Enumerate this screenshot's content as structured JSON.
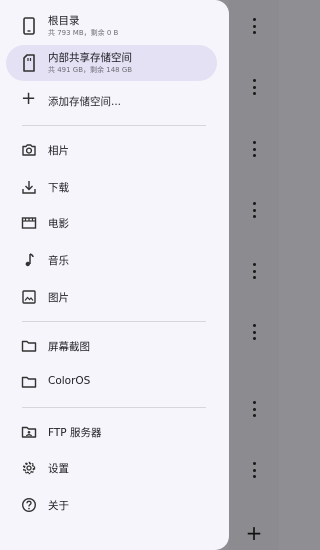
{
  "storage": [
    {
      "title": "根目录",
      "subtitle": "共 793 MB，剩余 0 B",
      "icon": "phone-icon",
      "active": false
    },
    {
      "title": "内部共享存储空间",
      "subtitle": "共 491 GB，剩余 148 GB",
      "icon": "sd-card-icon",
      "active": true
    }
  ],
  "add_storage": {
    "label": "添加存储空间..."
  },
  "library": [
    {
      "label": "相片",
      "icon": "camera-icon"
    },
    {
      "label": "下载",
      "icon": "download-icon"
    },
    {
      "label": "电影",
      "icon": "movie-icon"
    },
    {
      "label": "音乐",
      "icon": "music-note-icon"
    },
    {
      "label": "图片",
      "icon": "image-icon"
    }
  ],
  "bookmarks": [
    {
      "label": "屏幕截图",
      "icon": "folder-icon"
    },
    {
      "label": "ColorOS",
      "icon": "folder-icon"
    }
  ],
  "tools": [
    {
      "label": "FTP 服务器",
      "icon": "ftp-folder-icon"
    },
    {
      "label": "设置",
      "icon": "gear-icon"
    },
    {
      "label": "关于",
      "icon": "help-icon"
    }
  ],
  "colors": {
    "drawer_bg": "#f6f5fb",
    "active_bg": "#e3e1f3",
    "scrim": "#8c8c90"
  }
}
